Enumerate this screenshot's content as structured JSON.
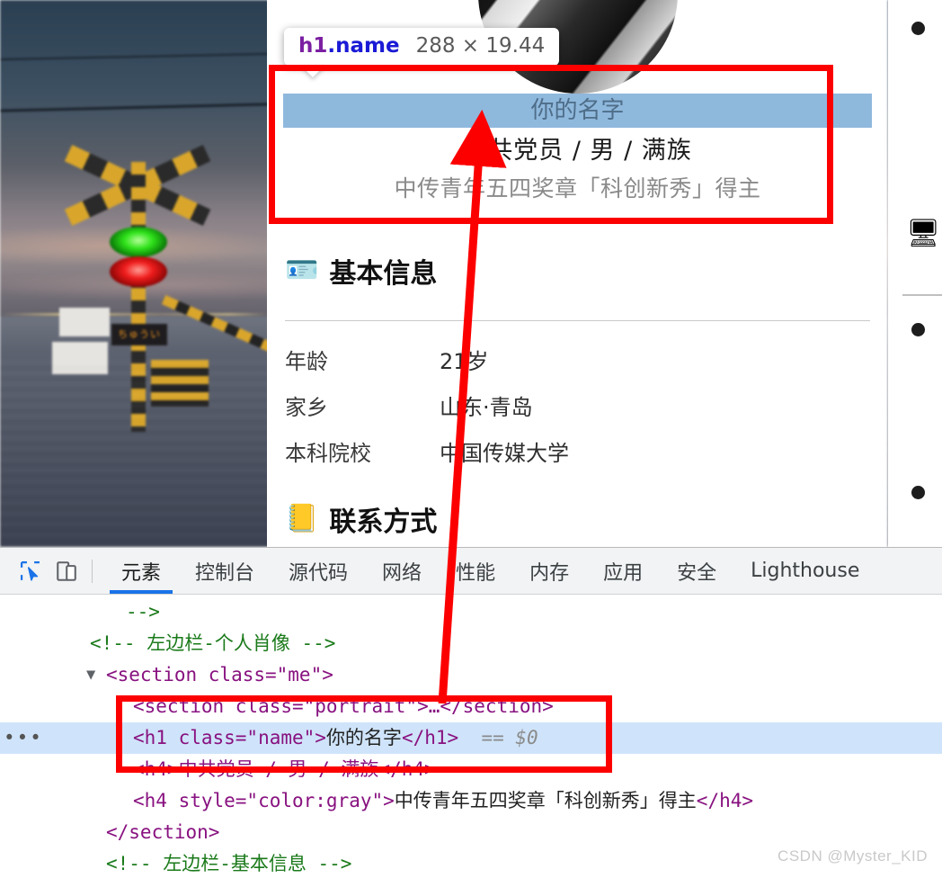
{
  "page": {
    "portrait_alt": "circular-black-and-white-portrait",
    "name": "你的名字",
    "subtitle_1": "中共党员 / 男 / 满族",
    "subtitle_2": "中传青年五四奖章「科创新秀」得主",
    "sections": [
      {
        "icon": "🪪",
        "icon_name": "id-badge-icon",
        "title": "基本信息",
        "rows": [
          {
            "key": "年龄",
            "value": "21岁"
          },
          {
            "key": "家乡",
            "value": "山东·青岛"
          },
          {
            "key": "本科院校",
            "value": "中国传媒大学"
          }
        ]
      },
      {
        "icon": "📒",
        "icon_name": "phone-book-icon",
        "title": "联系方式",
        "rows": []
      }
    ],
    "right_column": {
      "icon": "🖥",
      "icon_name": "computer-icon",
      "bullets": [
        "",
        "",
        ""
      ]
    }
  },
  "tooltip": {
    "tag_element": "h1",
    "tag_class": ".name",
    "dimensions": "288 × 19.44"
  },
  "devtools": {
    "icons": [
      {
        "name": "inspect-element-icon",
        "glyph": "inspect"
      },
      {
        "name": "device-toolbar-icon",
        "glyph": "device"
      }
    ],
    "tabs": [
      {
        "label": "元素",
        "active": true
      },
      {
        "label": "控制台",
        "active": false
      },
      {
        "label": "源代码",
        "active": false
      },
      {
        "label": "网络",
        "active": false
      },
      {
        "label": "性能",
        "active": false
      },
      {
        "label": "内存",
        "active": false
      },
      {
        "label": "应用",
        "active": false
      },
      {
        "label": "安全",
        "active": false
      },
      {
        "label": "Lighthouse",
        "active": false
      }
    ],
    "code": {
      "line_cut": "-->",
      "line_comment_1": "<!-- 左边栏-个人肖像 -->",
      "line_section_open": "<section class=\"me\">",
      "line_portrait": "<section class=\"portrait\">…</section>",
      "line_h1_open": "<h1 class=\"name\">",
      "line_h1_text": "你的名字",
      "line_h1_close": "</h1>",
      "line_h1_marker": "== $0",
      "line_h4_1": "<h4>中共党员 / 男 / 满族</h4>",
      "line_h4_2_open": "<h4 style=\"color:gray\">",
      "line_h4_2_text": "中传青年五四奖章「科创新秀」得主",
      "line_h4_2_close": "</h4>",
      "line_section_close": "</section>",
      "line_comment_2": "<!-- 左边栏-基本信息 -->",
      "ellipsis": "•••"
    },
    "watermark": "CSDN @Myster_KID"
  },
  "colors": {
    "highlight_blue": "#8fb8dd",
    "annotation_red": "#fc0000",
    "devtools_accent": "#1a73e8",
    "selected_row": "#cfe4fa"
  }
}
